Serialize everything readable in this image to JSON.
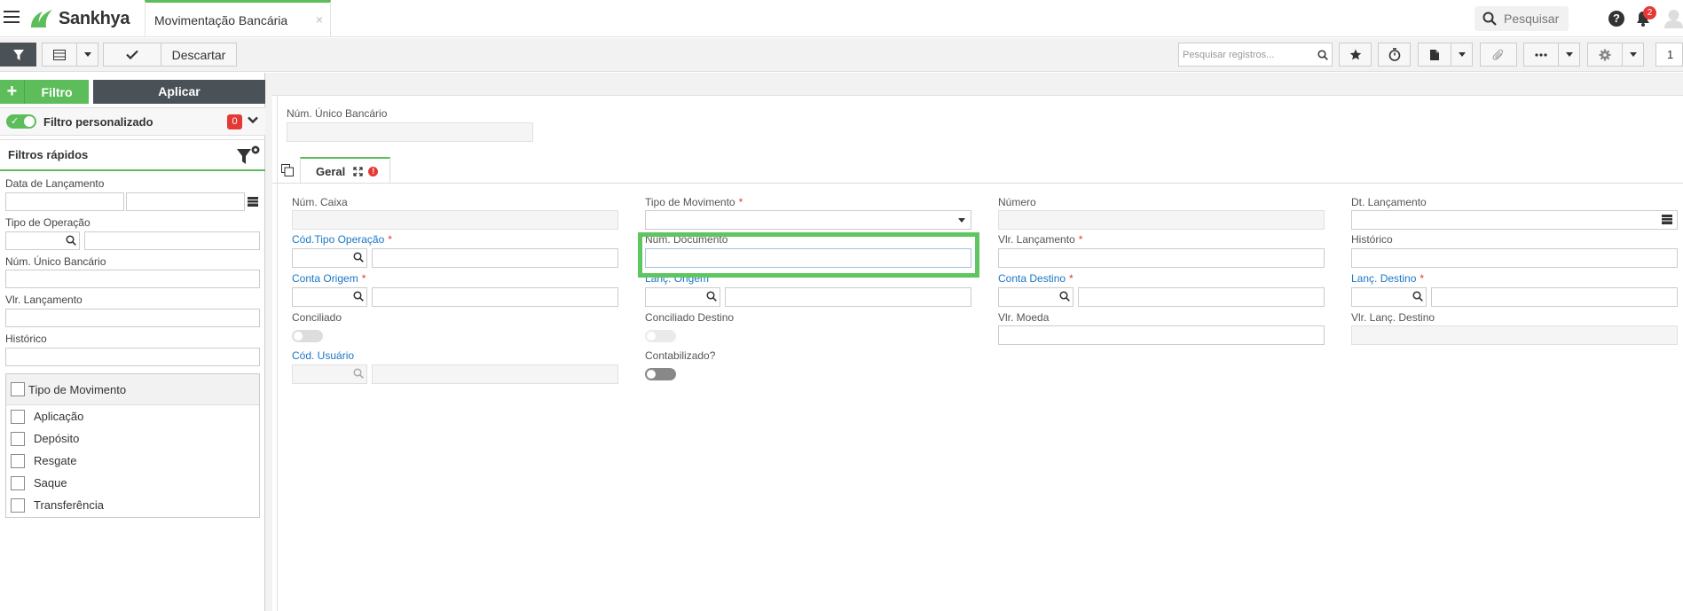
{
  "app": {
    "brand": "Sankhya",
    "tab_title": "Movimentação Bancária",
    "tab_close": "×"
  },
  "topbar": {
    "search_placeholder": "Pesquisar",
    "help": "?",
    "notifications_count": "2"
  },
  "toolbar": {
    "descartar_label": "Descartar",
    "search_placeholder": "Pesquisar registros...",
    "page": "1"
  },
  "left": {
    "filtro_label": "Filtro",
    "aplicar_label": "Aplicar",
    "filtro_personalizado": "Filtro personalizado",
    "filtro_count": "0",
    "filtros_rapidos": "Filtros rápidos",
    "fields": {
      "data_lancamento": "Data de Lançamento",
      "tipo_operacao": "Tipo de Operação",
      "num_unico_bancario": "Núm. Único Bancário",
      "vlr_lancamento": "Vlr. Lançamento",
      "historico": "Histórico"
    },
    "tipo_movimento": {
      "title": "Tipo de Movimento",
      "items": [
        "Aplicação",
        "Depósito",
        "Resgate",
        "Saque",
        "Transferência"
      ]
    }
  },
  "main": {
    "num_unico_bancario": "Núm. Único Bancário",
    "tab_geral": "Geral",
    "fields": {
      "num_caixa": "Núm. Caixa",
      "tipo_movimento": "Tipo de Movimento",
      "numero": "Número",
      "dt_lancamento": "Dt. Lançamento",
      "cod_tipo_operacao": "Cód.Tipo Operação",
      "num_documento": "Núm. Documento",
      "vlr_lancamento": "Vlr. Lançamento",
      "historico": "Histórico",
      "conta_origem": "Conta Origem",
      "lanc_origem": "Lanç. Origem",
      "conta_destino": "Conta Destino",
      "lanc_destino": "Lanç. Destino",
      "conciliado": "Conciliado",
      "conciliado_destino": "Conciliado Destino",
      "vlr_moeda": "Vlr. Moeda",
      "vlr_lanc_destino": "Vlr. Lanç. Destino",
      "cod_usuario": "Cód. Usuário",
      "contabilizado": "Contabilizado?"
    },
    "required_mark": "*"
  },
  "colors": {
    "accent": "#5cbd5a",
    "dark": "#4a5157",
    "link": "#1b77c6",
    "required": "#e53935"
  }
}
